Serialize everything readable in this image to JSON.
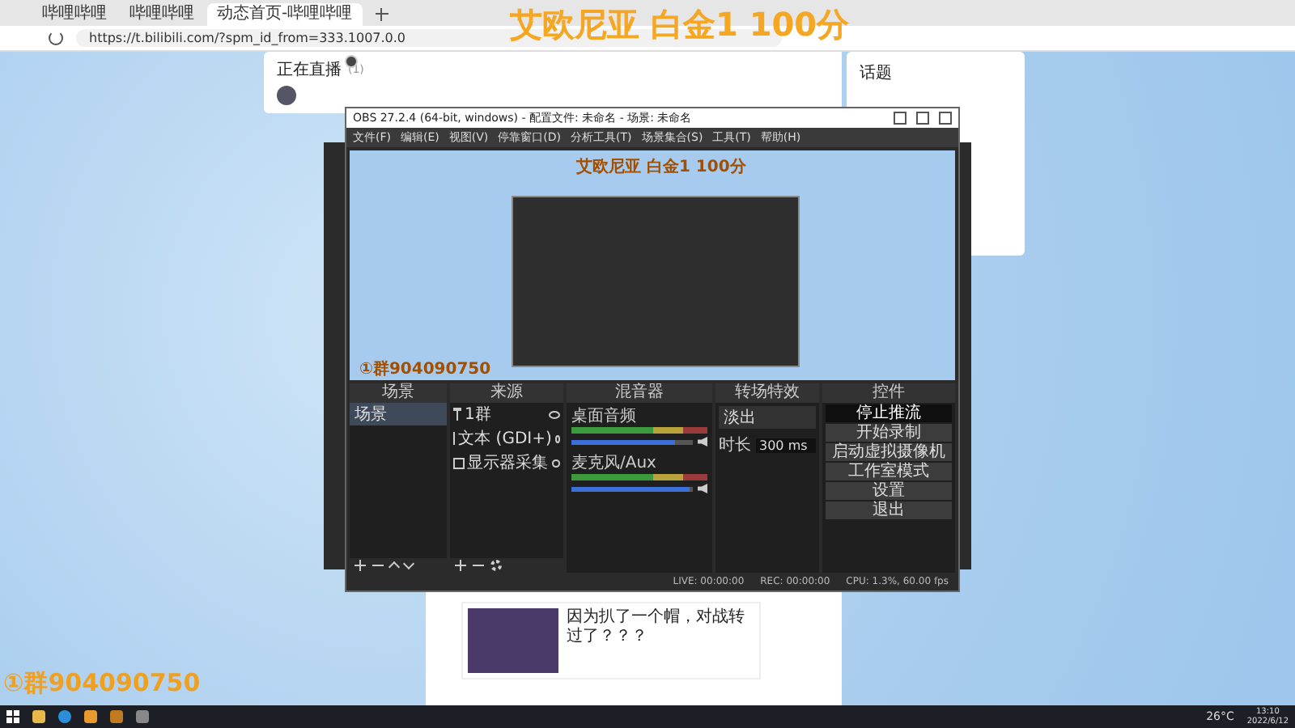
{
  "browser": {
    "tabs": [
      {
        "label": "哔哩哔哩",
        "selected": false
      },
      {
        "label": "哔哩哔哩",
        "selected": false
      },
      {
        "label": "动态首页-哔哩哔哩",
        "selected": true
      }
    ],
    "url": "https://t.bilibili.com/?spm_id_from=333.1007.0.0"
  },
  "overlay": {
    "title": "艾欧尼亚 白金1 100分",
    "group": "①群904090750"
  },
  "live_card": {
    "title": "正在直播",
    "count": "(1)"
  },
  "topic_card": {
    "title": "话题"
  },
  "post": {
    "title": "因为扒了一个帽，对战转过了？？？"
  },
  "obs": {
    "title": "OBS 27.2.4 (64-bit, windows) - 配置文件: 未命名 - 场景: 未命名",
    "menu": [
      "文件(F)",
      "编辑(E)",
      "视图(V)",
      "停靠窗口(D)",
      "分析工具(T)",
      "场景集合(S)",
      "工具(T)",
      "帮助(H)"
    ],
    "preview": {
      "title": "艾欧尼亚 白金1 100分",
      "group": "①群904090750"
    },
    "docks": [
      "场景",
      "来源",
      "混音器",
      "转场特效",
      "控件"
    ],
    "scenes": [
      {
        "label": "场景",
        "selected": true
      }
    ],
    "sources": [
      {
        "kind": "text",
        "label": "1群"
      },
      {
        "kind": "text",
        "label": "文本 (GDI+)"
      },
      {
        "kind": "display",
        "label": "显示器采集"
      }
    ],
    "mixer": [
      {
        "name": "桌面音频",
        "level": 0.85
      },
      {
        "name": "麦克风/Aux",
        "level": 0.97
      }
    ],
    "transition": {
      "type": "淡出",
      "duration_label": "时长",
      "duration": "300 ms"
    },
    "controls": [
      {
        "label": "停止推流",
        "highlighted": true
      },
      {
        "label": "开始录制",
        "highlighted": false
      },
      {
        "label": "启动虚拟摄像机",
        "highlighted": false
      },
      {
        "label": "工作室模式",
        "highlighted": false
      },
      {
        "label": "设置",
        "highlighted": false
      },
      {
        "label": "退出",
        "highlighted": false
      }
    ],
    "status": [
      "LIVE: 00:00:00",
      "REC: 00:00:00",
      "CPU: 1.3%, 60.00 fps"
    ]
  },
  "taskbar": {
    "weather": "26°C",
    "time": "13:10",
    "date": "2022/6/12"
  }
}
